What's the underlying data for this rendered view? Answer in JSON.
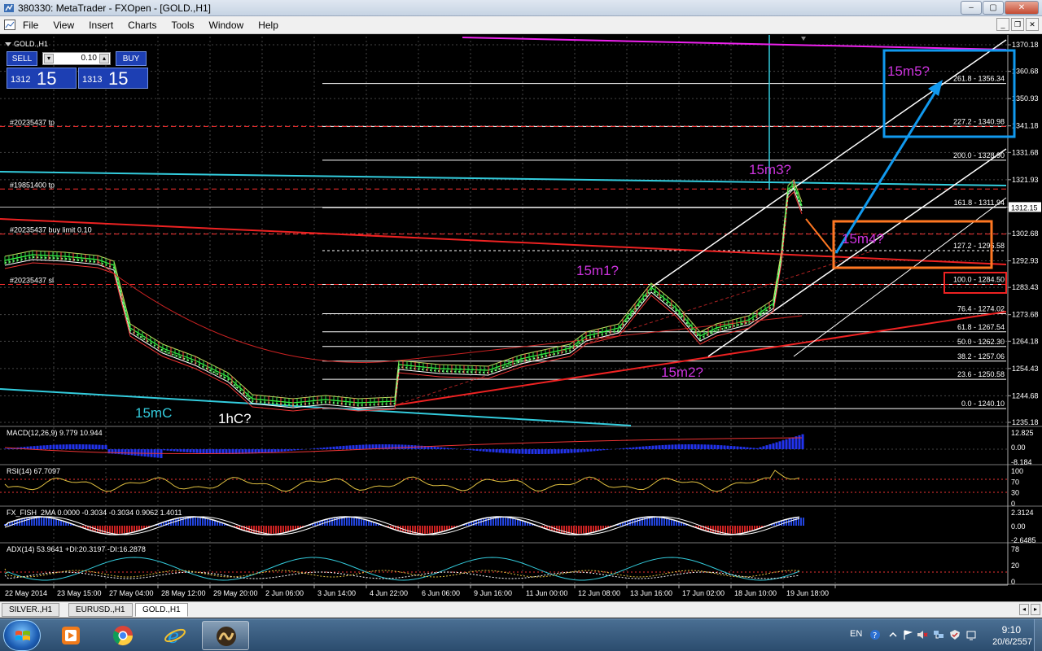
{
  "window": {
    "title": "380330: MetaTrader - FXOpen - [GOLD.,H1]",
    "min": "–",
    "max": "▢",
    "close": "✕"
  },
  "menu": [
    "File",
    "View",
    "Insert",
    "Charts",
    "Tools",
    "Window",
    "Help"
  ],
  "chart": {
    "symbol_label": "GOLD.,H1",
    "trade": {
      "sell": "SELL",
      "buy": "BUY",
      "lot": "0.10",
      "sell_small": "1312",
      "sell_big": "15",
      "buy_small": "1313",
      "buy_big": "15"
    },
    "order_labels": [
      {
        "text": "#20235437 tp"
      },
      {
        "text": "#19851400 tp"
      },
      {
        "text": "#20235437 buy limit 0.10"
      },
      {
        "text": "#20235437 sl"
      }
    ],
    "price_axis": [
      "1370.18",
      "1360.68",
      "1350.93",
      "1341.18",
      "1331.68",
      "1321.93",
      "1312.15",
      "1302.68",
      "1292.93",
      "1283.43",
      "1273.68",
      "1264.18",
      "1254.43",
      "1244.68",
      "1235.18"
    ],
    "current_price": "1312.15",
    "fib_levels": [
      "261.8 - 1356.34",
      "227.2 - 1340.98",
      "200.0 - 1328.90",
      "161.8 - 1311.94",
      "127.2 - 1296.58",
      "100.0 - 1284.50",
      "76.4 - 1274.02",
      "61.8 - 1267.54",
      "50.0 - 1262.30",
      "38.2 - 1257.06",
      "23.6 - 1250.58",
      "0.0 - 1240.10"
    ],
    "annotations": {
      "m5": "15m5?",
      "m3": "15m3?",
      "m4": "15m4?",
      "m1": "15m1?",
      "m2": "15m2?",
      "mC": "15mC",
      "hC": "1hC?"
    },
    "time_axis": [
      "22 May 2014",
      "23 May 15:00",
      "27 May 04:00",
      "28 May 12:00",
      "29 May 20:00",
      "2 Jun 06:00",
      "3 Jun 14:00",
      "4 Jun 22:00",
      "6 Jun 06:00",
      "9 Jun 16:00",
      "11 Jun 00:00",
      "12 Jun 08:00",
      "13 Jun 16:00",
      "17 Jun 02:00",
      "18 Jun 10:00",
      "19 Jun 18:00"
    ],
    "indicators": {
      "macd": {
        "label": "MACD(12,26,9) 9.779 10.944",
        "ticks": [
          "12.825",
          "0.00",
          "-8.184"
        ]
      },
      "rsi": {
        "label": "RSI(14) 67.7097",
        "ticks": [
          "100",
          "70",
          "30",
          "0"
        ]
      },
      "fx": {
        "label": "FX_FISH_2MA 0.0000 -0.3034 -0.3034 0.9062 1.4011",
        "ticks": [
          "2.3124",
          "0.00",
          "-2.6485"
        ]
      },
      "adx": {
        "label": "ADX(14) 53.9641 +DI:20.3197 -DI:16.2878",
        "ticks": [
          "78",
          "20",
          "0"
        ]
      }
    }
  },
  "tabs": [
    "SILVER.,H1",
    "EURUSD.,H1",
    "GOLD.,H1"
  ],
  "taskbar": {
    "lang": "EN",
    "time": "9:10",
    "date": "20/6/2557"
  },
  "colors": {
    "fib": "#ffffff",
    "order_line": "#ff3030",
    "cyan": "#33ccdd",
    "magenta": "#ee22ee",
    "blue_box": "#1199ee",
    "orange_box": "#ff7722",
    "red_box": "#ee2222",
    "green": "#33ff44"
  }
}
